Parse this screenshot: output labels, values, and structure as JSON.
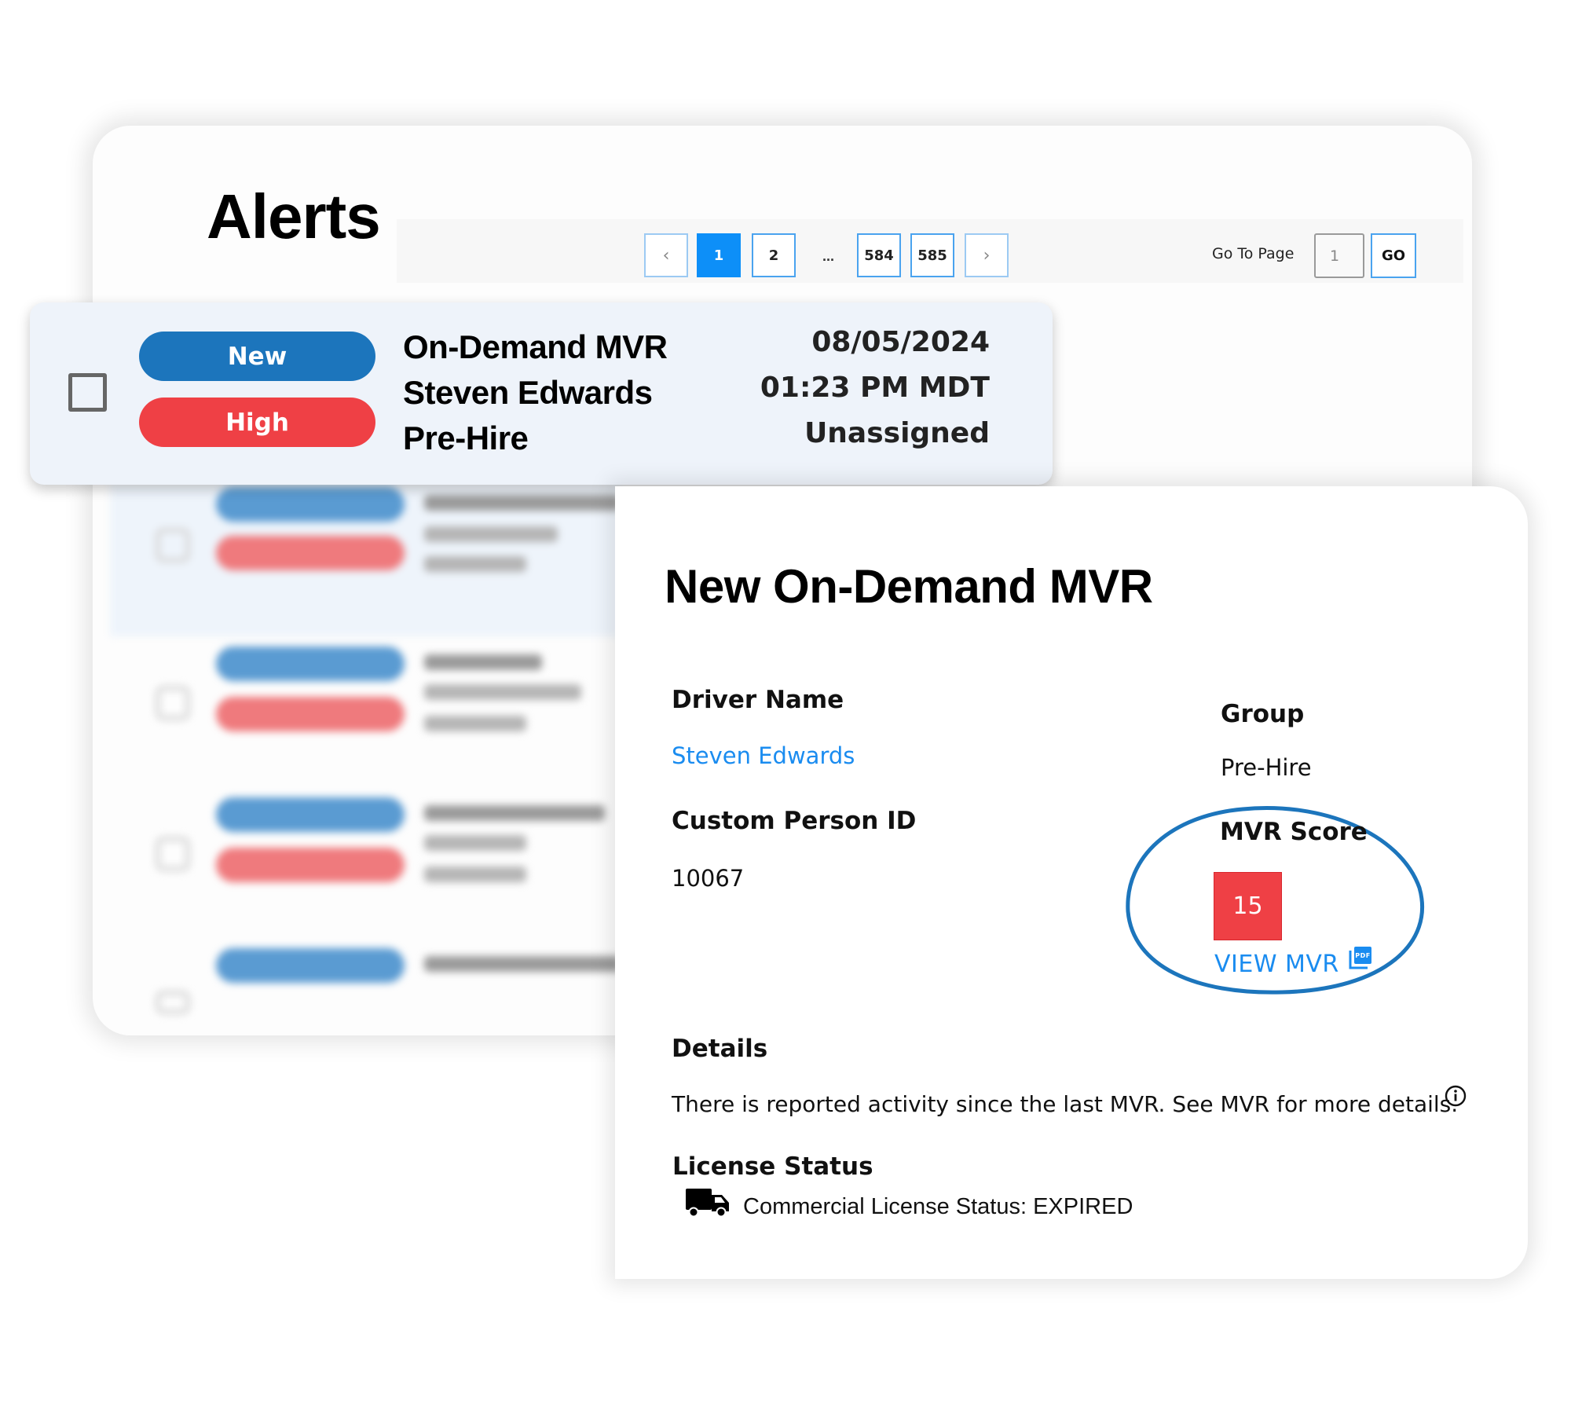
{
  "alerts_panel": {
    "title": "Alerts",
    "pagination": {
      "prev_icon": "chevron-left-icon",
      "next_icon": "chevron-right-icon",
      "pages": [
        "1",
        "2",
        "584",
        "585"
      ],
      "current_page": "1",
      "ellipsis": "...",
      "go_to_page_label": "Go To Page",
      "go_to_page_value": "1",
      "go_button": "GO"
    },
    "background_rows_count": 4
  },
  "selected_alert": {
    "checked": false,
    "status_badge": "New",
    "priority_badge": "High",
    "alert_type": "On-Demand MVR",
    "driver": "Steven Edwards",
    "group": "Pre-Hire",
    "date": "08/05/2024",
    "time": "01:23 PM MDT",
    "assignee": "Unassigned"
  },
  "detail": {
    "title": "New On-Demand MVR",
    "driver_name_label": "Driver Name",
    "driver_name": "Steven Edwards",
    "custom_person_id_label": "Custom Person ID",
    "custom_person_id": "10067",
    "group_label": "Group",
    "group": "Pre-Hire",
    "mvr_score_label": "MVR Score",
    "mvr_score": "15",
    "view_mvr": "VIEW MVR",
    "pdf_icon_label": "PDF",
    "details_label": "Details",
    "details_text": "There is reported activity since the last MVR. See MVR for more details.",
    "license_status_label": "License Status",
    "license_status_text": "Commercial License Status: EXPIRED"
  },
  "colors": {
    "badge_new": "#1c75bc",
    "badge_high": "#ef4045",
    "link": "#1a8cf0",
    "page_active": "#0d8ff8",
    "score_high": "#ef4045",
    "highlight_ring": "#1c75bc"
  }
}
